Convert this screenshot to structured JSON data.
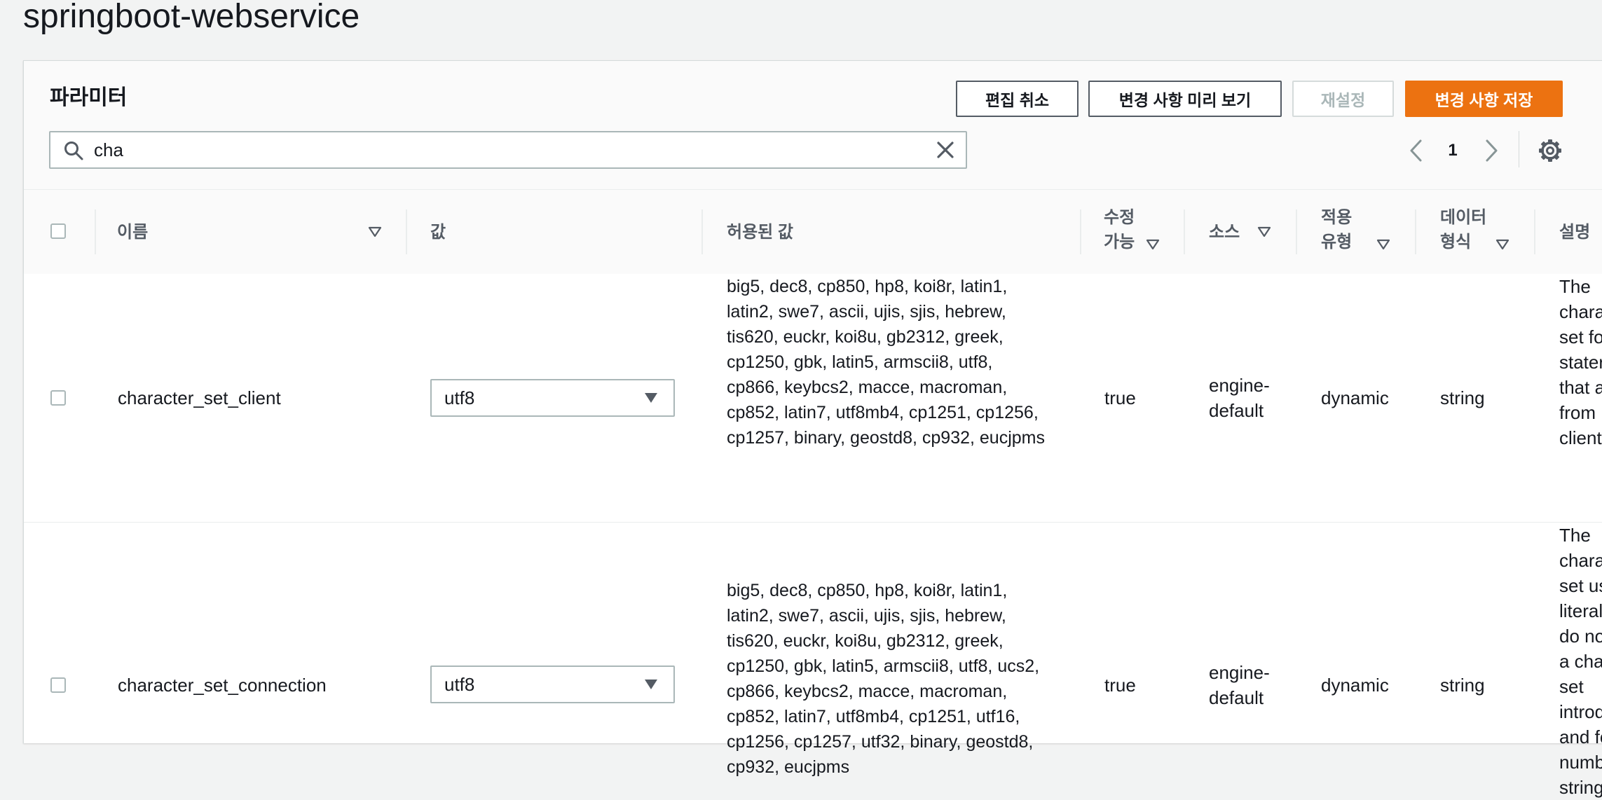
{
  "page": {
    "title": "springboot-webservice"
  },
  "panel": {
    "title": "파라미터",
    "buttons": {
      "cancel_edit": "편집 취소",
      "preview_changes": "변경 사항 미리 보기",
      "reset": "재설정",
      "save_changes": "변경 사항 저장"
    },
    "search": {
      "value": "cha",
      "placeholder": ""
    },
    "pagination": {
      "current_page": "1"
    }
  },
  "table": {
    "headers": {
      "name": "이름",
      "value": "값",
      "allowed_values": "허용된 값",
      "modifiable_line1": "수정",
      "modifiable_line2": "가능",
      "source": "소스",
      "apply_type_line1": "적용",
      "apply_type_line2": "유형",
      "data_type_line1": "데이터",
      "data_type_line2": "형식",
      "description": "설명"
    },
    "rows": [
      {
        "name": "character_set_client",
        "value": "utf8",
        "allowed_lines": [
          "big5, dec8, cp850, hp8, koi8r, latin1,",
          "latin2, swe7, ascii, ujis, sjis, hebrew,",
          "tis620, euckr, koi8u, gb2312, greek,",
          "cp1250, gbk, latin5, armscii8, utf8,",
          "cp866, keybcs2, macce, macroman,",
          "cp852, latin7, utf8mb4, cp1251, cp1256,",
          "cp1257, binary, geostd8, cp932, eucjpms"
        ],
        "modifiable": "true",
        "source_line1": "engine-",
        "source_line2": "default",
        "apply_type": "dynamic",
        "data_type": "string",
        "description_lines": [
          "The",
          "chara",
          "set fo",
          "stater",
          "that a",
          "from",
          "client"
        ]
      },
      {
        "name": "character_set_connection",
        "value": "utf8",
        "allowed_lines": [
          "big5, dec8, cp850, hp8, koi8r, latin1,",
          "latin2, swe7, ascii, ujis, sjis, hebrew,",
          "tis620, euckr, koi8u, gb2312, greek,",
          "cp1250, gbk, latin5, armscii8, utf8, ucs2,",
          "cp866, keybcs2, macce, macroman,",
          "cp852, latin7, utf8mb4, cp1251, utf16,",
          "cp1256, cp1257, utf32, binary, geostd8,",
          "cp932, eucjpms"
        ],
        "modifiable": "true",
        "source_line1": "engine-",
        "source_line2": "default",
        "apply_type": "dynamic",
        "data_type": "string",
        "description_lines": [
          "The",
          "chara",
          "set us",
          "literal",
          "do no",
          "a char",
          "set",
          "introd",
          "and fo",
          "numb",
          "string"
        ]
      }
    ]
  },
  "icons": {
    "search": "search-icon",
    "clear": "close-icon",
    "prev": "chevron-left-icon",
    "next": "chevron-right-icon",
    "settings": "gear-icon",
    "sort": "sort-caret-down-icon",
    "dropdown": "caret-down-icon"
  },
  "colors": {
    "primary": "#ec7211",
    "border": "#aab7b8",
    "text": "#16191f",
    "muted": "#545b64"
  }
}
